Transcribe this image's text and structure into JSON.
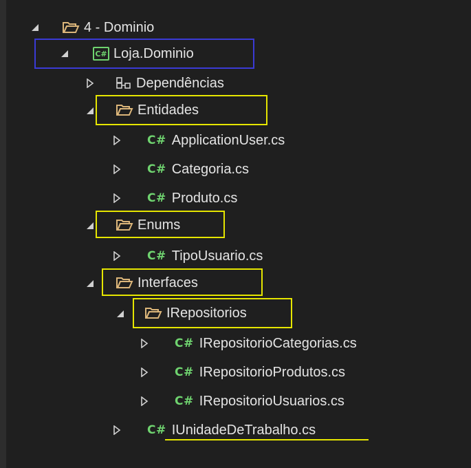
{
  "tree": {
    "domain_folder": "4 - Dominio",
    "project": "Loja.Dominio",
    "project_icon": "C#",
    "dependencies": "Dependências",
    "entidades": {
      "label": "Entidades",
      "files": [
        "ApplicationUser.cs",
        "Categoria.cs",
        "Produto.cs"
      ]
    },
    "enums": {
      "label": "Enums",
      "files": [
        "TipoUsuario.cs"
      ]
    },
    "interfaces": {
      "label": "Interfaces",
      "repositorios": {
        "label": "IRepositorios",
        "files": [
          "IRepositorioCategorias.cs",
          "IRepositorioProdutos.cs",
          "IRepositorioUsuarios.cs"
        ]
      },
      "files": [
        "IUnidadeDeTrabalho.cs"
      ]
    },
    "cs_badge": "C#"
  },
  "colors": {
    "background": "#1f1f1f",
    "highlight_yellow": "#e6e600",
    "highlight_blue": "#3a3ad6",
    "csharp_green": "#6fd36f",
    "folder_tan": "#dcb67a"
  }
}
